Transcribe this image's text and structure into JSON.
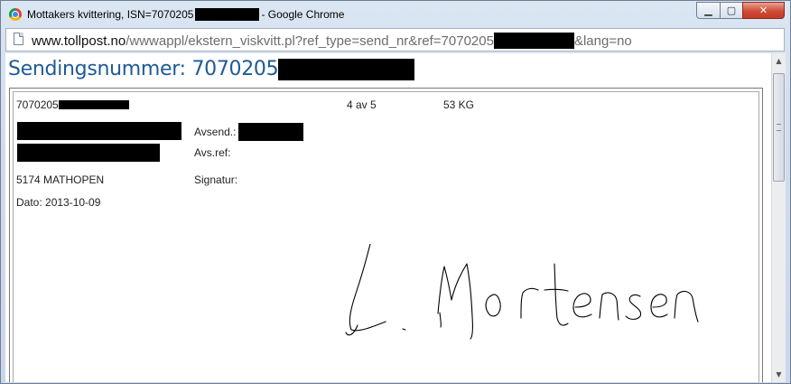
{
  "window": {
    "title_prefix": "Mottakers kvittering, ISN=7070205",
    "title_suffix": "- Google Chrome",
    "minimize_glyph": "▁",
    "maximize_glyph": "▢",
    "close_glyph": "✕",
    "icons": [
      "chrome-icon",
      "page-icon"
    ]
  },
  "address_bar": {
    "host": "www.tollpost.no",
    "path_prefix": "/wwwappl/ekstern_viskvitt.pl?ref_type=send_nr&ref=7070205",
    "path_suffix": "&lang=no"
  },
  "page": {
    "title_prefix": "Sendingsnummer: 7070205",
    "title_color": "#1f5a96"
  },
  "receipt": {
    "shipment_number_prefix": "7070205",
    "package_count": "4 av 5",
    "weight": "53 KG",
    "sender_label": "Avsend.:",
    "sender_ref_label": "Avs.ref:",
    "postal_code_city": "5174 MATHOPEN",
    "signature_label": "Signatur:",
    "date_label": "Dato: 2013-10-09",
    "signature_name": "L. Mortensen"
  }
}
